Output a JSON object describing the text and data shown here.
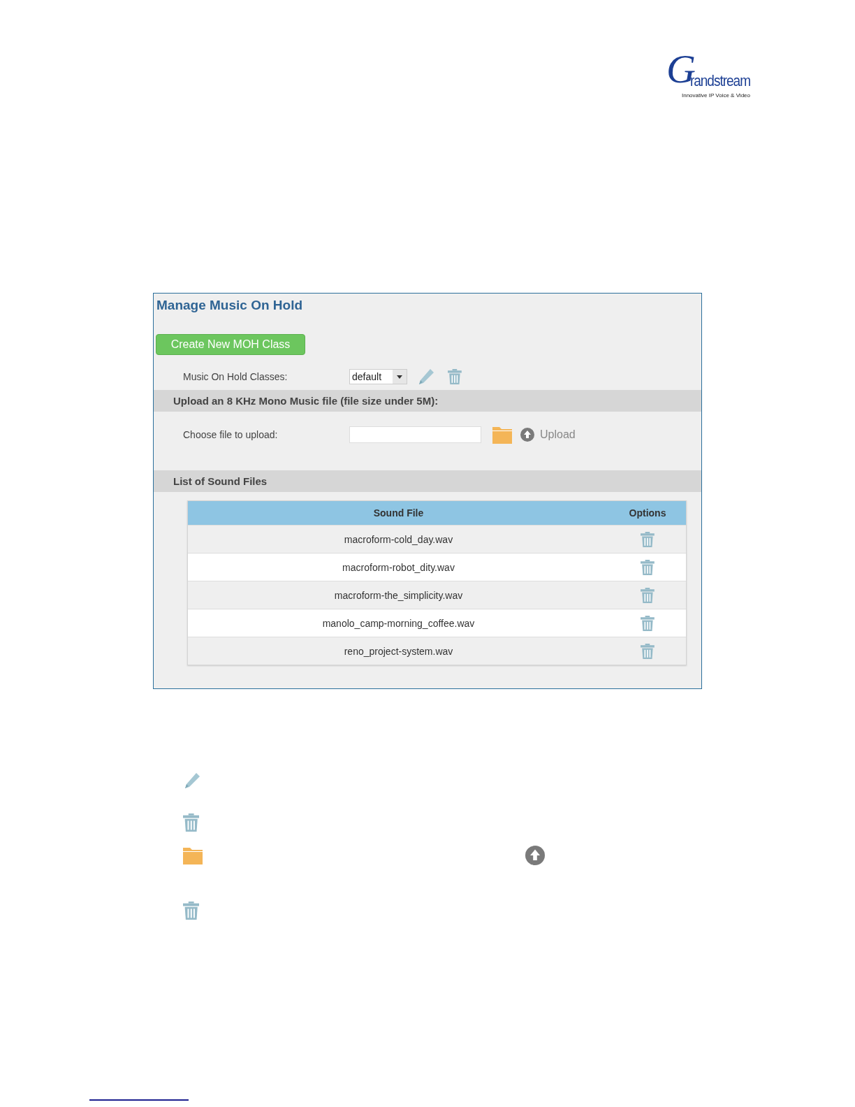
{
  "logo": {
    "mark": "G",
    "name": "randstream",
    "tagline": "Innovative IP Voice & Video"
  },
  "panel": {
    "title": "Manage Music On Hold",
    "create_button": "Create New MOH Class",
    "classes_label": "Music On Hold Classes:",
    "classes_select": {
      "value": "default"
    },
    "upload_section": "Upload an 8 KHz Mono Music file (file size under 5M):",
    "choose_label": "Choose file to upload:",
    "upload_button": "Upload",
    "list_section": "List of Sound Files",
    "table": {
      "columns": [
        "Sound File",
        "Options"
      ],
      "rows": [
        {
          "sound_file": "macroform-cold_day.wav"
        },
        {
          "sound_file": "macroform-robot_dity.wav"
        },
        {
          "sound_file": "macroform-the_simplicity.wav"
        },
        {
          "sound_file": "manolo_camp-morning_coffee.wav"
        },
        {
          "sound_file": "reno_project-system.wav"
        }
      ]
    }
  }
}
